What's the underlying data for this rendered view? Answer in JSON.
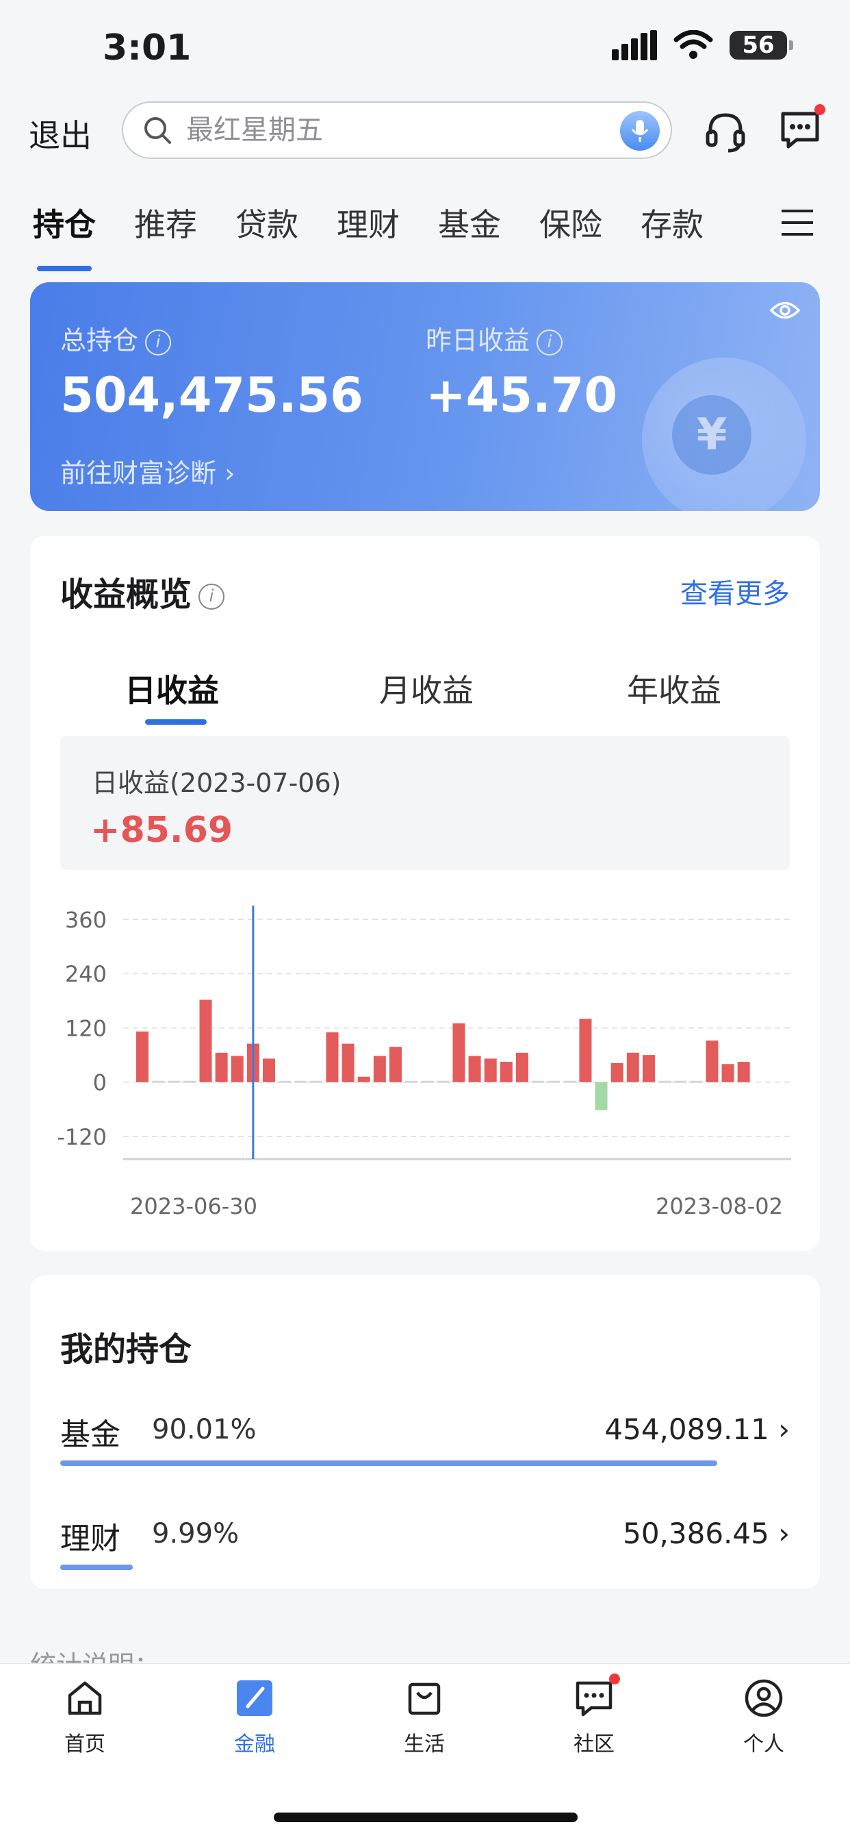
{
  "status": {
    "time": "3:01",
    "battery": "56"
  },
  "header": {
    "exit_label": "退出",
    "search_placeholder": "最红星期五"
  },
  "tabs": [
    {
      "label": "持仓",
      "active": true
    },
    {
      "label": "推荐"
    },
    {
      "label": "贷款"
    },
    {
      "label": "理财"
    },
    {
      "label": "基金"
    },
    {
      "label": "保险"
    },
    {
      "label": "存款"
    }
  ],
  "assets": {
    "total_label": "总持仓",
    "total_value": "504,475.56",
    "yesterday_label": "昨日收益",
    "yesterday_value": "+45.70",
    "diagnose_link": "前往财富诊断 ›"
  },
  "income": {
    "title": "收益概览",
    "more": "查看更多",
    "periods": [
      "日收益",
      "月收益",
      "年收益"
    ],
    "selected_label": "日收益(2023-07-06)",
    "selected_value": "+85.69"
  },
  "chart_data": {
    "type": "bar",
    "yticks": [
      "360",
      "240",
      "120",
      "0",
      "-120"
    ],
    "ylim": [
      -170,
      360
    ],
    "x_start_label": "2023-06-30",
    "x_end_label": "2023-08-02",
    "values": [
      112,
      0,
      0,
      0,
      182,
      65,
      58,
      85,
      52,
      0,
      0,
      0,
      110,
      85,
      12,
      58,
      78,
      0,
      0,
      0,
      130,
      58,
      52,
      45,
      65,
      0,
      0,
      0,
      140,
      -62,
      42,
      65,
      60,
      0,
      0,
      0,
      92,
      40,
      45
    ],
    "positive_color": "#e45b5b",
    "negative_color": "#a3d9a5",
    "zero_color": "#d6d6d6",
    "selected_index": 7
  },
  "holdings": {
    "title": "我的持仓",
    "items": [
      {
        "name": "基金",
        "pct": "90.01%",
        "value": "454,089.11 ›",
        "ratio": 0.9001
      },
      {
        "name": "理财",
        "pct": "9.99%",
        "value": "50,386.45 ›",
        "ratio": 0.0999
      }
    ],
    "footnote": "统计说明："
  },
  "nav": [
    {
      "label": "首页"
    },
    {
      "label": "金融",
      "active": true
    },
    {
      "label": "生活"
    },
    {
      "label": "社区"
    },
    {
      "label": "个人"
    }
  ]
}
